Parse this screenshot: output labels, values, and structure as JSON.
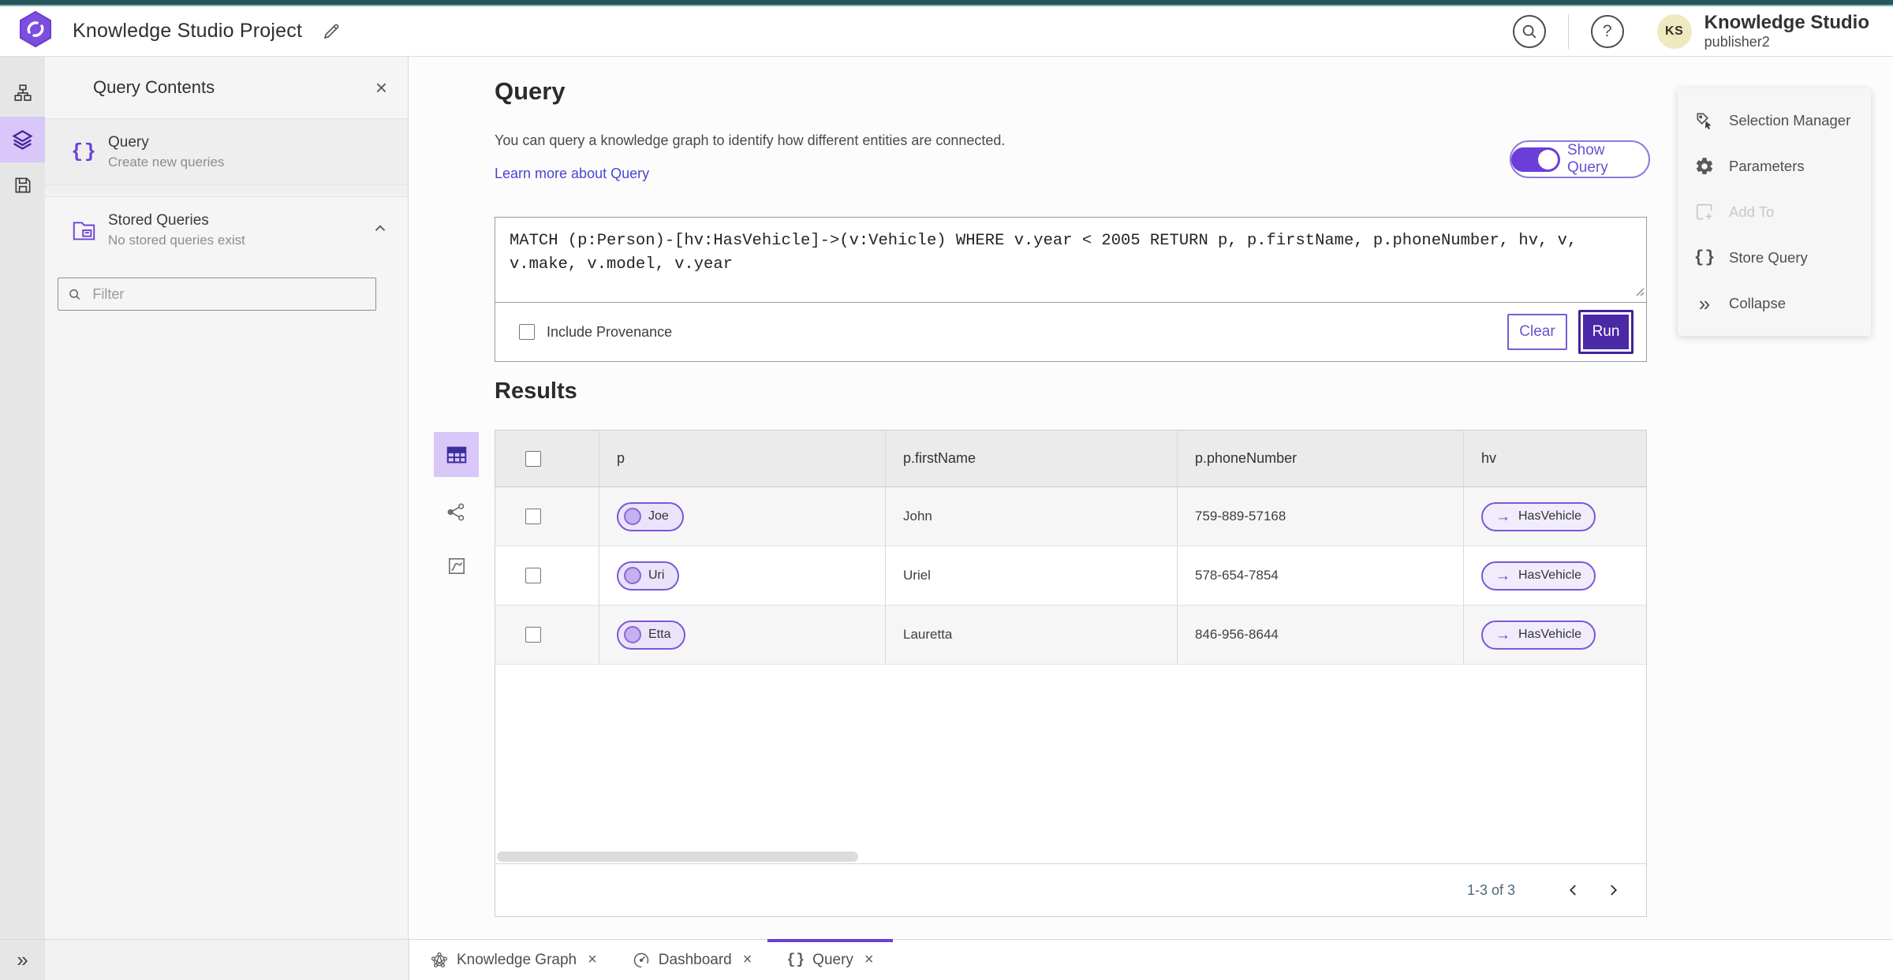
{
  "app": {
    "title": "Knowledge Studio Project",
    "product_name": "Knowledge Studio",
    "user_name": "publisher2",
    "avatar_initials": "KS"
  },
  "side_panel": {
    "title": "Query Contents",
    "query_item": {
      "title": "Query",
      "subtitle": "Create new queries"
    },
    "stored_queries": {
      "title": "Stored Queries",
      "subtitle": "No stored queries exist"
    },
    "filter_placeholder": "Filter"
  },
  "query_section": {
    "heading": "Query",
    "description": "You can query a knowledge graph to identify how different entities are connected.",
    "learn_more_link": "Learn more about Query",
    "show_query_label": "Show Query",
    "query_text": "MATCH (p:Person)-[hv:HasVehicle]->(v:Vehicle) WHERE v.year < 2005 RETURN p, p.firstName, p.phoneNumber, hv, v, v.make, v.model, v.year",
    "include_provenance_label": "Include Provenance",
    "clear_button": "Clear",
    "run_button": "Run"
  },
  "results_section": {
    "heading": "Results",
    "columns": [
      "p",
      "p.firstName",
      "p.phoneNumber",
      "hv"
    ],
    "rows": [
      {
        "p": "Joe",
        "p_firstName": "John",
        "p_phoneNumber": "759-889-57168",
        "hv": "HasVehicle"
      },
      {
        "p": "Uri",
        "p_firstName": "Uriel",
        "p_phoneNumber": "578-654-7854",
        "hv": "HasVehicle"
      },
      {
        "p": "Etta",
        "p_firstName": "Lauretta",
        "p_phoneNumber": "846-956-8644",
        "hv": "HasVehicle"
      }
    ],
    "pagination_label": "1-3 of 3"
  },
  "context_menu": {
    "items": [
      {
        "label": "Selection Manager",
        "disabled": false
      },
      {
        "label": "Parameters",
        "disabled": false
      },
      {
        "label": "Add To",
        "disabled": true
      },
      {
        "label": "Store Query",
        "disabled": false
      },
      {
        "label": "Collapse",
        "disabled": false
      }
    ]
  },
  "bottom_tabs": [
    {
      "label": "Knowledge Graph",
      "active": false
    },
    {
      "label": "Dashboard",
      "active": false
    },
    {
      "label": "Query",
      "active": true
    }
  ],
  "colors": {
    "accent_purple": "#6a43d6",
    "deep_purple": "#4b28a5",
    "link_purple": "#4b45cf",
    "active_item_bg": "#d8c7f8",
    "pill_bg": "#ebe3fa",
    "top_strip_teal": "#26565c",
    "avatar_bg": "#efe9c0"
  }
}
